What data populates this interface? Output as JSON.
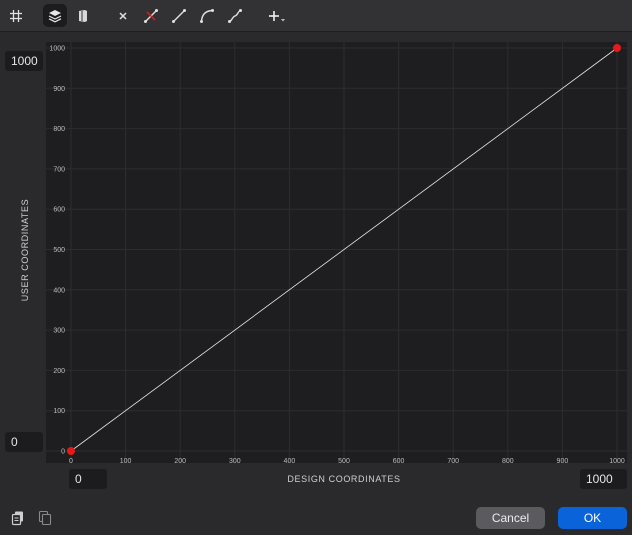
{
  "toolbar": {
    "items": [
      {
        "icon": "grid-icon",
        "active": false
      },
      {
        "icon": "layers-icon",
        "active": true
      },
      {
        "icon": "book-icon",
        "active": false
      },
      {
        "icon": "close-icon",
        "active": false
      },
      {
        "icon": "remove-curve-icon",
        "active": false
      },
      {
        "icon": "line-curve-icon",
        "active": false
      },
      {
        "icon": "arc-curve-icon",
        "active": false
      },
      {
        "icon": "s-curve-icon",
        "active": false
      },
      {
        "icon": "add-point-icon",
        "active": false
      }
    ]
  },
  "axes": {
    "y_title": "USER COORDINATES",
    "x_title": "DESIGN COORDINATES"
  },
  "fields": {
    "user_max": "1000",
    "user_min": "0",
    "design_min": "0",
    "design_max": "1000"
  },
  "buttons": {
    "cancel": "Cancel",
    "ok": "OK"
  },
  "colors": {
    "accent": "#0a63d8",
    "point": "#e8191b",
    "line": "#e6e6e6"
  },
  "chart_data": {
    "type": "line",
    "x": [
      0,
      1000
    ],
    "y": [
      0,
      1000
    ],
    "xlabel": "DESIGN COORDINATES",
    "ylabel": "USER COORDINATES",
    "xlim": [
      0,
      1000
    ],
    "ylim": [
      0,
      1000
    ],
    "xticks": [
      0,
      100,
      200,
      300,
      400,
      500,
      600,
      700,
      800,
      900,
      1000
    ],
    "yticks": [
      0,
      100,
      200,
      300,
      400,
      500,
      600,
      700,
      800,
      900,
      1000
    ],
    "grid": true
  }
}
